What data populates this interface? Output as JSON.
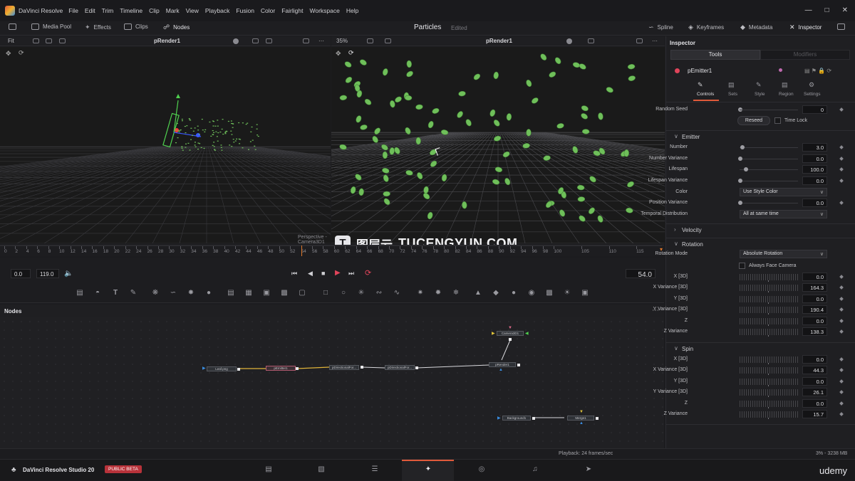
{
  "app": {
    "name": "DaVinci Resolve",
    "menus": [
      "File",
      "Edit",
      "Trim",
      "Timeline",
      "Clip",
      "Mark",
      "View",
      "Playback",
      "Fusion",
      "Color",
      "Fairlight",
      "Workspace",
      "Help"
    ]
  },
  "toolbar": {
    "media_pool": "Media Pool",
    "effects": "Effects",
    "clips": "Clips",
    "nodes": "Nodes",
    "project": "Particles",
    "project_status": "Edited",
    "spline": "Spline",
    "keyframes": "Keyframes",
    "metadata": "Metadata",
    "inspector": "Inspector"
  },
  "viewer_left": {
    "zoom": "Fit",
    "title": "pRender1",
    "overlay": "Perspective - Camera3D1"
  },
  "viewer_right": {
    "zoom": "35%",
    "title": "pRender1"
  },
  "watermark": {
    "cn": "图层云",
    "en": "TUCENGYUN.COM"
  },
  "ruler": {
    "ticks": [
      "0",
      "2",
      "4",
      "6",
      "8",
      "10",
      "12",
      "14",
      "16",
      "18",
      "20",
      "22",
      "24",
      "26",
      "28",
      "30",
      "32",
      "34",
      "36",
      "38",
      "40",
      "42",
      "44",
      "46",
      "48",
      "50",
      "52",
      "54",
      "56",
      "58",
      "60",
      "62",
      "64",
      "66",
      "68",
      "70",
      "72",
      "74",
      "76",
      "78",
      "80",
      "82",
      "84",
      "86",
      "88",
      "90",
      "92",
      "94",
      "96",
      "98",
      "100",
      "105",
      "110",
      "115"
    ],
    "playhead": 54
  },
  "transport": {
    "start": "0.0",
    "end": "119.0",
    "current": "54.0"
  },
  "nodes_panel": {
    "title": "Nodes",
    "nodes": {
      "loader": "Leaf.png",
      "emitter": "pEmitter1",
      "dir1": "pDirectionalFor...",
      "dir2": "pDirectionalFor...",
      "render": "pRender1",
      "camera": "Camera3D1",
      "background": "Background1",
      "merge": "Merge1"
    }
  },
  "status": {
    "playback": "Playback: 24 frames/sec",
    "memory": "3% - 3238 MB"
  },
  "footer": {
    "app_title": "DaVinci Resolve Studio 20",
    "badge": "PUBLIC BETA",
    "brand": "udemy"
  },
  "inspector": {
    "title": "Inspector",
    "tabs": [
      "Tools",
      "Modifiers"
    ],
    "tool_name": "pEmitter1",
    "subtabs": [
      "Controls",
      "Sets",
      "Style",
      "Region",
      "Settings"
    ],
    "random_seed": {
      "label": "Random Seed",
      "value": "0"
    },
    "reseed": "Reseed",
    "time_lock": "Time Lock",
    "emitter_section": "Emitter",
    "number": {
      "label": "Number",
      "value": "3.0"
    },
    "number_variance": {
      "label": "Number Variance",
      "value": "0.0"
    },
    "lifespan": {
      "label": "Lifespan",
      "value": "100.0"
    },
    "lifespan_variance": {
      "label": "Lifespan Variance",
      "value": "0.0"
    },
    "color": {
      "label": "Color",
      "value": "Use Style Color"
    },
    "position_variance": {
      "label": "Position Variance",
      "value": "0.0"
    },
    "temporal": {
      "label": "Temporal Distribution",
      "value": "All at same time"
    },
    "velocity_section": "Velocity",
    "rotation_section": "Rotation",
    "rotation_mode": {
      "label": "Rotation Mode",
      "value": "Absolute Rotation"
    },
    "always_face_camera": "Always Face Camera",
    "rot_x": {
      "label": "X [3D]",
      "value": "0.0"
    },
    "rot_xv": {
      "label": "X Variance [3D]",
      "value": "164.3"
    },
    "rot_y": {
      "label": "Y [3D]",
      "value": "0.0"
    },
    "rot_yv": {
      "label": "Y Variance [3D]",
      "value": "190.4"
    },
    "rot_z": {
      "label": "Z",
      "value": "0.0"
    },
    "rot_zv": {
      "label": "Z Variance",
      "value": "138.3"
    },
    "spin_section": "Spin",
    "spin_x": {
      "label": "X [3D]",
      "value": "0.0"
    },
    "spin_xv": {
      "label": "X Variance [3D]",
      "value": "44.3"
    },
    "spin_y": {
      "label": "Y [3D]",
      "value": "0.0"
    },
    "spin_yv": {
      "label": "Y Variance [3D]",
      "value": "26.1"
    },
    "spin_z": {
      "label": "Z",
      "value": "0.0"
    },
    "spin_zv": {
      "label": "Z Variance",
      "value": "15.7"
    }
  },
  "colors": {
    "accent": "#e05a3a",
    "leaf": "#6fbf5a",
    "playhead": "#e0782a"
  }
}
